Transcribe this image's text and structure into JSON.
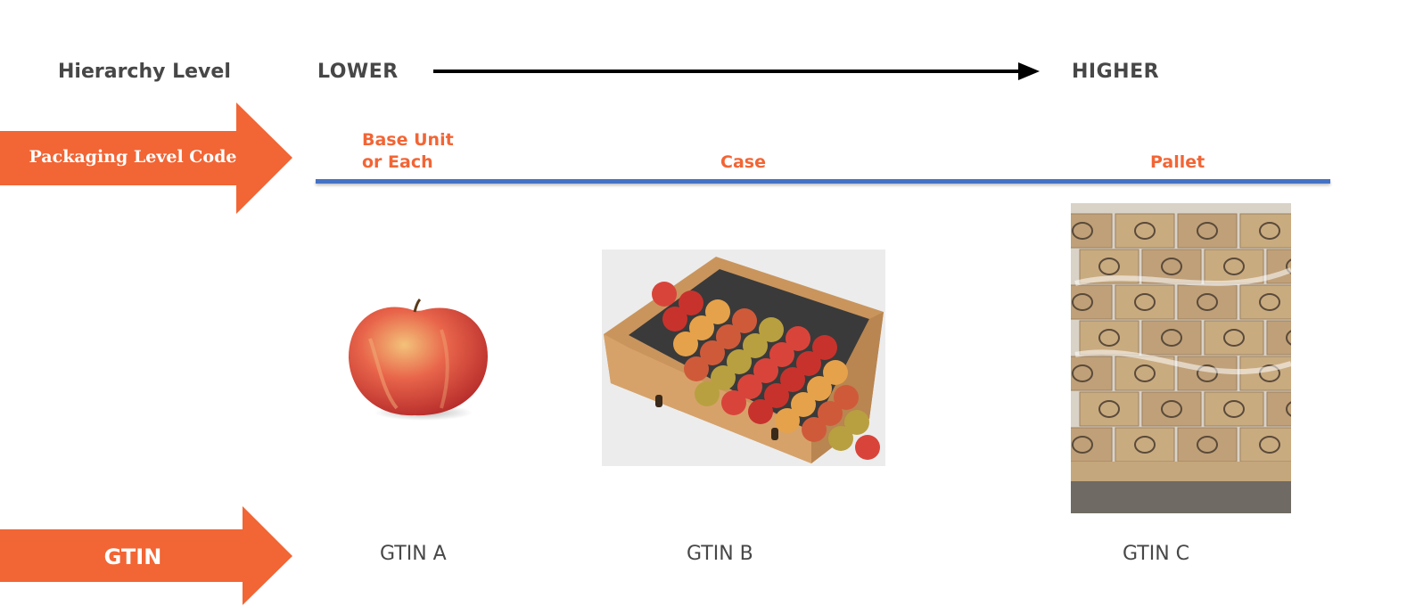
{
  "hierarchy": {
    "label": "Hierarchy Level",
    "lower": "LOWER",
    "higher": "HIGHER"
  },
  "packaging_level_code": {
    "label": "Packaging Level Code",
    "levels": [
      {
        "line1": "Base Unit",
        "line2": "or Each"
      },
      {
        "line1": "Case"
      },
      {
        "line1": "Pallet"
      }
    ]
  },
  "gtin": {
    "label": "GTIN",
    "values": [
      "GTIN A",
      "GTIN B",
      "GTIN C"
    ]
  },
  "images": [
    {
      "name": "apple-image",
      "description": "Single apple"
    },
    {
      "name": "apple-case-image",
      "description": "Cardboard case of apples"
    },
    {
      "name": "pallet-image",
      "description": "Pallet of stacked apple boxes"
    }
  ],
  "colors": {
    "accent": "#f26535",
    "line": "#4472c4",
    "text": "#474747"
  }
}
